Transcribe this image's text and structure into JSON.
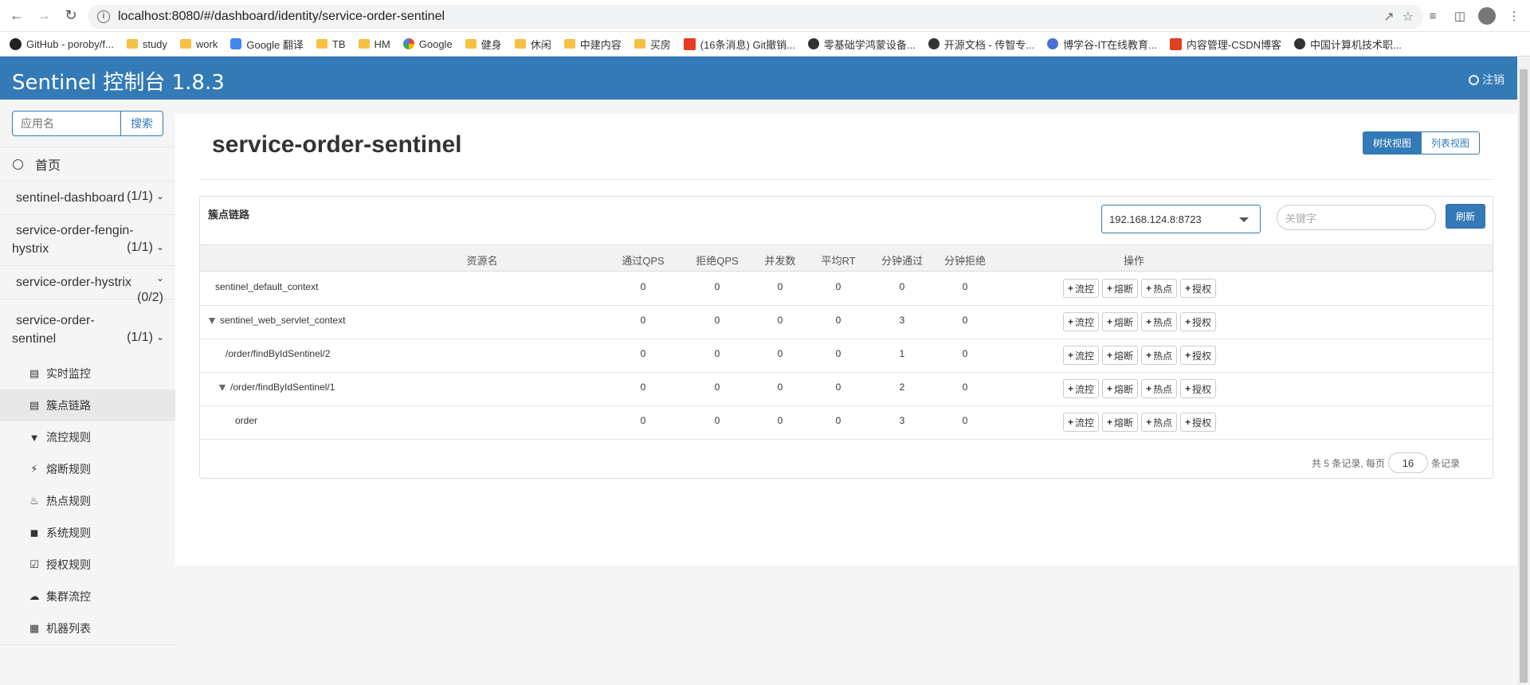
{
  "browser": {
    "url": "localhost:8080/#/dashboard/identity/service-order-sentinel",
    "bookmarks": [
      {
        "label": "GitHub - poroby/f...",
        "icon": "github-icon"
      },
      {
        "label": "study",
        "icon": "folder-icon"
      },
      {
        "label": "work",
        "icon": "folder-icon"
      },
      {
        "label": "Google 翻译",
        "icon": "google-translate-icon"
      },
      {
        "label": "TB",
        "icon": "folder-icon"
      },
      {
        "label": "HM",
        "icon": "folder-icon"
      },
      {
        "label": "Google",
        "icon": "google-icon"
      },
      {
        "label": "健身",
        "icon": "folder-icon"
      },
      {
        "label": "休闲",
        "icon": "folder-icon"
      },
      {
        "label": "中建内容",
        "icon": "folder-icon"
      },
      {
        "label": "买房",
        "icon": "folder-icon"
      },
      {
        "label": "(16条消息) Git撤销...",
        "icon": "csdn-icon"
      },
      {
        "label": "零基础学鸿蒙设备...",
        "icon": "site-icon"
      },
      {
        "label": "开源文档 - 传智专...",
        "icon": "site-icon"
      },
      {
        "label": "博学谷-IT在线教育...",
        "icon": "boxuegu-icon"
      },
      {
        "label": "内容管理-CSDN博客",
        "icon": "csdn-icon"
      },
      {
        "label": "中国计算机技术职...",
        "icon": "site-icon"
      }
    ]
  },
  "header": {
    "title": "Sentinel 控制台 1.8.3",
    "logout": "注销"
  },
  "sidebar": {
    "search_placeholder": "应用名",
    "search_button": "搜索",
    "home": "首页",
    "apps": [
      {
        "name": "sentinel-dashboard",
        "count": "(1/1)"
      },
      {
        "name_line1": "service-order-fengin-",
        "name_line2": "hystrix",
        "count": "(1/1)"
      },
      {
        "name": "service-order-hystrix",
        "count": "(0/2)"
      },
      {
        "name_line1": "service-order-",
        "name_line2": "sentinel",
        "count": "(1/1)"
      }
    ],
    "menu": [
      {
        "label": "实时监控",
        "icon": "bar-chart-icon"
      },
      {
        "label": "簇点链路",
        "icon": "list-icon"
      },
      {
        "label": "流控规则",
        "icon": "filter-icon"
      },
      {
        "label": "熔断规则",
        "icon": "lightning-icon"
      },
      {
        "label": "热点规则",
        "icon": "fire-icon"
      },
      {
        "label": "系统规则",
        "icon": "lock-icon"
      },
      {
        "label": "授权规则",
        "icon": "check-square-icon"
      },
      {
        "label": "集群流控",
        "icon": "cloud-icon"
      },
      {
        "label": "机器列表",
        "icon": "th-list-icon"
      }
    ]
  },
  "main": {
    "page_title": "service-order-sentinel",
    "view_tree": "树状视图",
    "view_list": "列表视图",
    "panel_title": "簇点链路",
    "machine": "192.168.124.8:8723",
    "keyword_placeholder": "关键字",
    "refresh": "刷新",
    "columns": [
      "资源名",
      "通过QPS",
      "拒绝QPS",
      "并发数",
      "平均RT",
      "分钟通过",
      "分钟拒绝",
      "操作"
    ],
    "rows": [
      {
        "resource": "sentinel_default_context",
        "expandable": false,
        "values": [
          "0",
          "0",
          "0",
          "0",
          "0",
          "0"
        ]
      },
      {
        "resource": "sentinel_web_servlet_context",
        "expandable": true,
        "values": [
          "0",
          "0",
          "0",
          "0",
          "3",
          "0"
        ]
      },
      {
        "resource": "/order/findByIdSentinel/2",
        "expandable": false,
        "values": [
          "0",
          "0",
          "0",
          "0",
          "1",
          "0"
        ]
      },
      {
        "resource": "/order/findByIdSentinel/1",
        "expandable": true,
        "values": [
          "0",
          "0",
          "0",
          "0",
          "2",
          "0"
        ]
      },
      {
        "resource": "order",
        "expandable": false,
        "values": [
          "0",
          "0",
          "0",
          "0",
          "3",
          "0"
        ]
      }
    ],
    "ops": [
      "流控",
      "熔断",
      "热点",
      "授权"
    ],
    "pager_prefix": "共 5 条记录, 每页",
    "page_size": "16",
    "pager_suffix": "条记录"
  }
}
